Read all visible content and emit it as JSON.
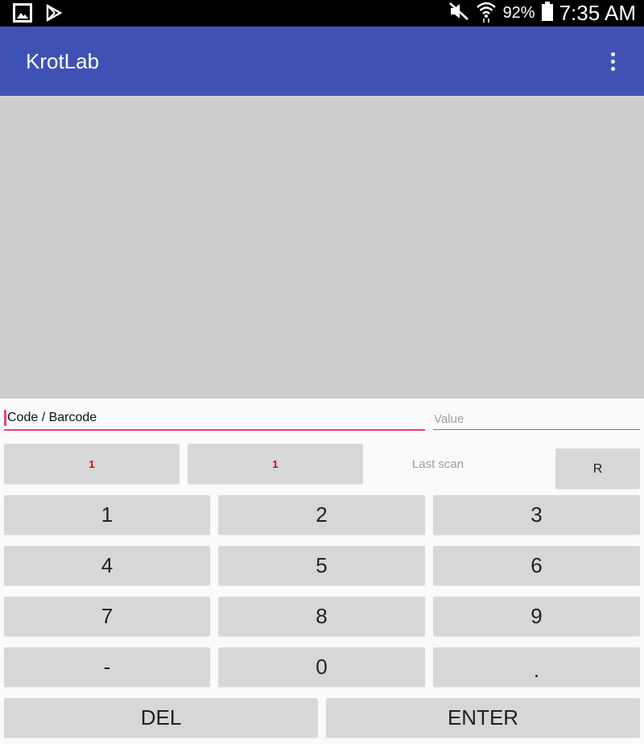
{
  "status_bar": {
    "icons": [
      "gallery-icon",
      "play-store-icon",
      "mute-icon",
      "wifi-icon",
      "battery-icon"
    ],
    "battery": "92%",
    "time": "7:35 AM"
  },
  "app_bar": {
    "title": "KrotLab",
    "color": "#3f51b5"
  },
  "form": {
    "code_value": "Code / Barcode",
    "value_placeholder": "Value",
    "accent_color": "#e8407a"
  },
  "scan_row": {
    "counter_a": "1",
    "counter_b": "1",
    "last_scan_label": "Last scan",
    "r_label": "R"
  },
  "keypad": {
    "k1": "1",
    "k2": "2",
    "k3": "3",
    "k4": "4",
    "k5": "5",
    "k6": "6",
    "k7": "7",
    "k8": "8",
    "k9": "9",
    "minus": "-",
    "k0": "0",
    "dot": ".",
    "del": "DEL",
    "enter": "ENTER"
  }
}
